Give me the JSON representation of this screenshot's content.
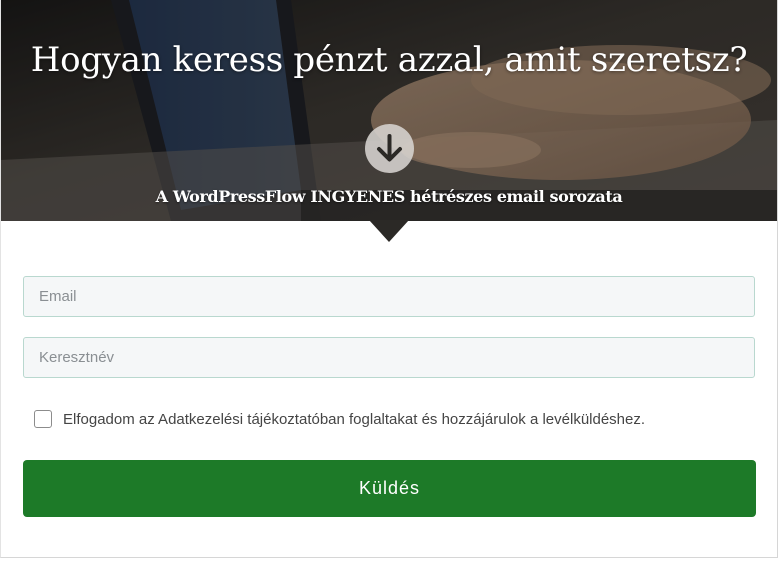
{
  "hero": {
    "title": "Hogyan keress pénzt azzal, amit szeretsz?",
    "subtitle": "A WordPressFlow INGYENES hétrészes email sorozata",
    "scroll_icon": "arrow-down-circle-icon",
    "image_icon": "laptop-typing-photo"
  },
  "form": {
    "email_placeholder": "Email",
    "email_value": "",
    "firstname_placeholder": "Keresztnév",
    "firstname_value": "",
    "consent_label": "Elfogadom az Adatkezelési tájékoztatóban foglaltakat és hozzájárulok a levélküldéshez.",
    "consent_checked": false,
    "submit_label": "Küldés"
  },
  "colors": {
    "submit_bg": "#1d7a28",
    "field_border": "#b9d8cf",
    "field_bg": "#f5f7f8",
    "hero_overlay": "#2a2723"
  }
}
